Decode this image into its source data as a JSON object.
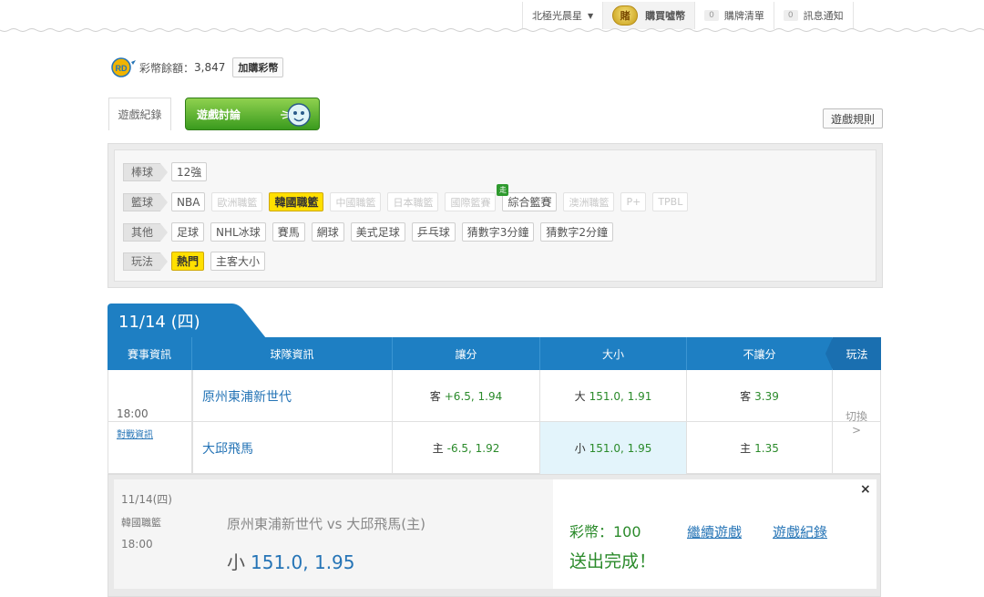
{
  "topnav": {
    "user": "北極光晨星",
    "buy_icon": "賭",
    "buy_label": "購買噓幣",
    "cart_count": "0",
    "cart_label": "購牌清單",
    "notify_count": "0",
    "notify_label": "訊息通知"
  },
  "coin": {
    "label": "彩幣餘額：",
    "value": "3,847",
    "add_label": "加購彩幣"
  },
  "tabs": {
    "history": "遊戲紀錄",
    "forum": "遊戲討論",
    "rules": "遊戲規則"
  },
  "filters": [
    {
      "category": "棒球",
      "chips": [
        {
          "label": "12強",
          "state": "normal"
        }
      ]
    },
    {
      "category": "籃球",
      "chips": [
        {
          "label": "NBA",
          "state": "normal"
        },
        {
          "label": "歐洲職籃",
          "state": "dim"
        },
        {
          "label": "韓國職籃",
          "state": "on"
        },
        {
          "label": "中國職籃",
          "state": "dim"
        },
        {
          "label": "日本職籃",
          "state": "dim"
        },
        {
          "label": "國際籃賽",
          "state": "dim"
        },
        {
          "label": "綜合籃賽",
          "state": "normal",
          "badge": "走"
        },
        {
          "label": "澳洲職籃",
          "state": "dim"
        },
        {
          "label": "P+",
          "state": "dim"
        },
        {
          "label": "TPBL",
          "state": "dim"
        }
      ]
    },
    {
      "category": "其他",
      "chips": [
        {
          "label": "足球",
          "state": "normal"
        },
        {
          "label": "NHL冰球",
          "state": "normal"
        },
        {
          "label": "賽馬",
          "state": "normal"
        },
        {
          "label": "網球",
          "state": "normal"
        },
        {
          "label": "美式足球",
          "state": "normal"
        },
        {
          "label": "乒乓球",
          "state": "normal"
        },
        {
          "label": "猜數字3分鐘",
          "state": "normal"
        },
        {
          "label": "猜數字2分鐘",
          "state": "normal"
        }
      ]
    },
    {
      "category": "玩法",
      "chips": [
        {
          "label": "熱門",
          "state": "on"
        },
        {
          "label": "主客大小",
          "state": "normal"
        }
      ]
    }
  ],
  "date_tab": "11/14 (四)",
  "table": {
    "headers": [
      "賽事資訊",
      "球隊資訊",
      "讓分",
      "大小",
      "不讓分",
      "玩法"
    ],
    "time": "18:00",
    "info_link": "對戰資訊",
    "rows": [
      {
        "team": "原州東浦新世代",
        "spread_side": "客",
        "spread_val": "+6.5, 1.94",
        "total_side": "大",
        "total_val": "151.0, 1.91",
        "ml_side": "客",
        "ml_val": "3.39"
      },
      {
        "team": "大邱飛馬",
        "spread_side": "主",
        "spread_val": "-6.5, 1.92",
        "total_side": "小",
        "total_val": "151.0, 1.95",
        "ml_side": "主",
        "ml_val": "1.35"
      }
    ],
    "switch_label": "切換",
    "switch_arrow": ">"
  },
  "result": {
    "date": "11/14(四)",
    "league": "韓國職籃",
    "time": "18:00",
    "match": "原州東浦新世代 vs 大邱飛馬(主)",
    "pick_side": "小",
    "pick_val": "151.0, 1.95",
    "coins": "彩幣：100",
    "done": "送出完成！",
    "continue_link": "繼續遊戲",
    "history_link": "遊戲紀錄",
    "close": "×"
  },
  "colors": {
    "primary": "#1e7fc3",
    "odds_green": "#2a8a2a",
    "highlight": "#ffe000"
  }
}
